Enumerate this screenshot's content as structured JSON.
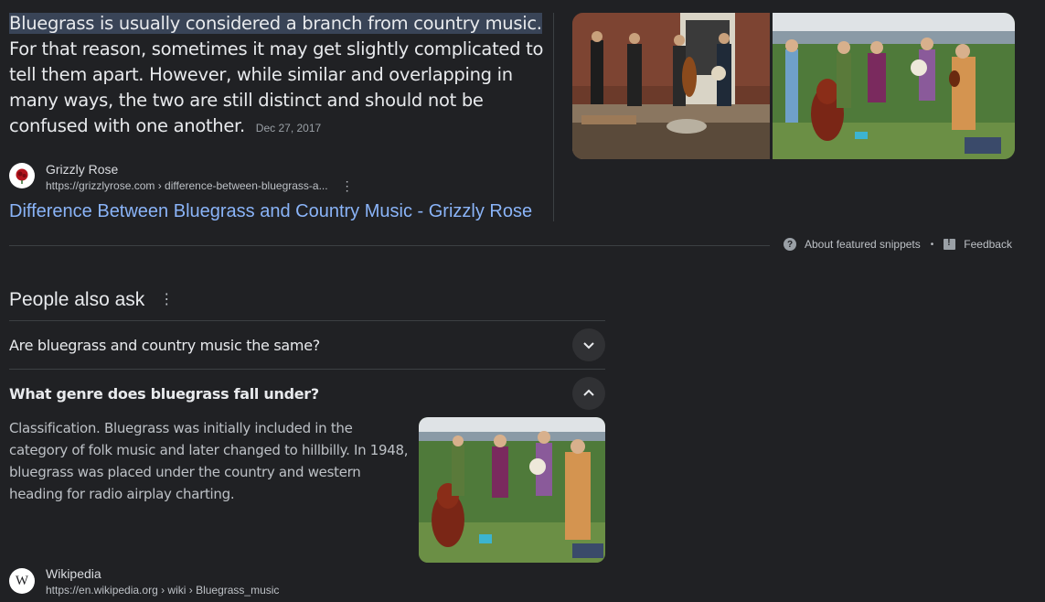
{
  "snippet": {
    "highlight": "Bluegrass is usually considered a branch from country music.",
    "rest": " For that reason, sometimes it may get slightly complicated to tell them apart. However, while similar and overlapping in many ways, the two are still distinct and should not be confused with one another.",
    "date": "Dec 27, 2017"
  },
  "source": {
    "name": "Grizzly Rose",
    "url": "https://grizzlyrose.com › difference-between-bluegrass-a...",
    "favicon_icon": "rose-icon",
    "link_title": "Difference Between Bluegrass and Country Music - Grizzly Rose"
  },
  "snippet_footer": {
    "about": "About featured snippets",
    "separator": "•",
    "feedback": "Feedback"
  },
  "people_also_ask": {
    "title": "People also ask",
    "questions": [
      {
        "text": "Are bluegrass and country music the same?",
        "expanded": false
      },
      {
        "text": "What genre does bluegrass fall under?",
        "expanded": true
      }
    ],
    "answer": {
      "text": "Classification. Bluegrass was initially included in the category of folk music and later changed to hillbilly. In 1948, bluegrass was placed under the country and western heading for radio airplay charting.",
      "source_name": "Wikipedia",
      "source_url": "https://en.wikipedia.org › wiki › Bluegrass_music",
      "favicon_letter": "W"
    }
  },
  "colors": {
    "background": "#202124",
    "link": "#8ab4f8",
    "highlight": "#394457"
  }
}
